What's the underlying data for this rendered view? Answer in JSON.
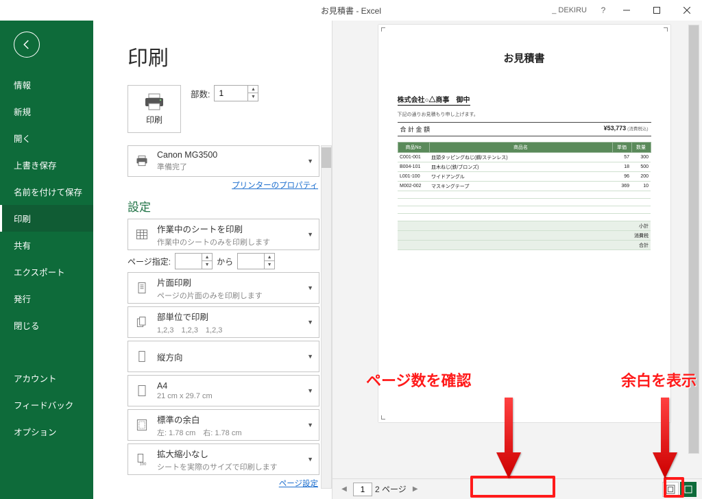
{
  "titlebar": {
    "title": "お見積書 - Excel",
    "user": "_ DEKIRU"
  },
  "sidebar": {
    "items": [
      "情報",
      "新規",
      "開く",
      "上書き保存",
      "名前を付けて保存",
      "印刷",
      "共有",
      "エクスポート",
      "発行",
      "閉じる"
    ],
    "items2": [
      "アカウント",
      "フィードバック",
      "オプション"
    ]
  },
  "panel": {
    "heading": "印刷",
    "print_label": "印刷",
    "copies_label": "部数:",
    "copies_value": "1",
    "printer": {
      "name": "Canon MG3500",
      "status": "準備完了"
    },
    "printer_link": "プリンターのプロパティ",
    "settings_heading": "設定",
    "scope": {
      "t1": "作業中のシートを印刷",
      "t2": "作業中のシートのみを印刷します"
    },
    "page_label": "ページ指定:",
    "to_label": "から",
    "duplex": {
      "t1": "片面印刷",
      "t2": "ページの片面のみを印刷します"
    },
    "collate": {
      "t1": "部単位で印刷",
      "t2": "1,2,3　1,2,3　1,2,3"
    },
    "orient": {
      "t1": "縦方向"
    },
    "paper": {
      "t1": "A4",
      "t2": "21 cm x 29.7 cm"
    },
    "margin": {
      "t1": "標準の余白",
      "t2": "左: 1.78 cm　右: 1.78 cm"
    },
    "scale": {
      "t1": "拡大縮小なし",
      "t2": "シートを実際のサイズで印刷します"
    },
    "page_setup_link": "ページ設定"
  },
  "preview": {
    "doc": {
      "title": "お見積書",
      "client": "株式会社○△商事　御中",
      "note": "下記の通りお見積もり申し上げます。",
      "total_label": "合 計 金 額",
      "total_value": "¥53,773",
      "tax_note": "(消費税込)",
      "headers": [
        "商品No",
        "商品名",
        "単価",
        "数量"
      ],
      "rows": [
        [
          "C001-001",
          "皿頭タッピングねじ(鋼/ステンレス)",
          "57",
          "300"
        ],
        [
          "B004-101",
          "皿木ねじ(鉄/ブロンズ)",
          "18",
          "500"
        ],
        [
          "L001-100",
          "ワイドアングル",
          "96",
          "200"
        ],
        [
          "M002-002",
          "マスキングテープ",
          "369",
          "10"
        ]
      ],
      "footers": [
        "小計",
        "消費税",
        "合計"
      ]
    },
    "pager": {
      "current": "1",
      "total": "2 ページ"
    }
  },
  "annotations": {
    "left": "ページ数を確認",
    "right": "余白を表示"
  }
}
